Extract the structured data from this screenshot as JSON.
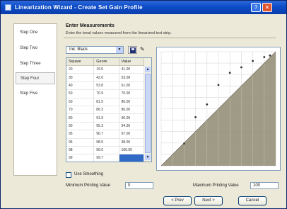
{
  "window": {
    "title": "Linearization Wizard - Create Set Gain Profile"
  },
  "sidebar": {
    "items": [
      {
        "label": "Step One",
        "active": false
      },
      {
        "label": "Step Two",
        "active": false
      },
      {
        "label": "Step Three",
        "active": false
      },
      {
        "label": "Step Four",
        "active": true
      },
      {
        "label": "Step Five",
        "active": false
      }
    ]
  },
  "panel": {
    "heading": "Enter Measurements",
    "description": "Enter the tonal values measured from the linearized test strip.",
    "ink_select": "Ink: Black",
    "table": {
      "columns": [
        "Square",
        "Genre",
        "Value"
      ],
      "rows": [
        [
          "20",
          "19.5",
          "41.00"
        ],
        [
          "30",
          "42.6",
          "53.08"
        ],
        [
          "40",
          "53.8",
          "61.00"
        ],
        [
          "50",
          "70.9",
          "70.00"
        ],
        [
          "60",
          "81.5",
          "80.00"
        ],
        [
          "70",
          "86.3",
          "86.00"
        ],
        [
          "80",
          "91.9",
          "90.00"
        ],
        [
          "90",
          "95.3",
          "94.00"
        ],
        [
          "95",
          "96.7",
          "97.00"
        ],
        [
          "96",
          "98.5",
          "98.00"
        ],
        [
          "98",
          "99.0",
          "100.00"
        ],
        [
          "99",
          "99.7",
          ""
        ]
      ]
    },
    "use_smoothing": "Use Smoothing",
    "min_label": "Minimum Printing Value",
    "min_value": "0",
    "max_label": "Maximum Printing Value",
    "max_value": "100"
  },
  "chart_data": {
    "type": "scatter",
    "x": [
      20,
      30,
      40,
      50,
      60,
      70,
      80,
      90,
      95
    ],
    "y": [
      19.5,
      42.6,
      53.8,
      70.9,
      81.5,
      86.3,
      91.9,
      95.3,
      96.7
    ],
    "xlim": [
      0,
      100
    ],
    "ylim": [
      0,
      100
    ],
    "grid": true,
    "fill_color": "#8f8a72",
    "title": "",
    "xlabel": "",
    "ylabel": ""
  },
  "buttons": {
    "back": "< Prev",
    "next": "Next >",
    "cancel": "Cancel"
  },
  "colors": {
    "titlebar": "#0d4cc8",
    "window": "#ece9d8",
    "selection": "#3169c6"
  }
}
